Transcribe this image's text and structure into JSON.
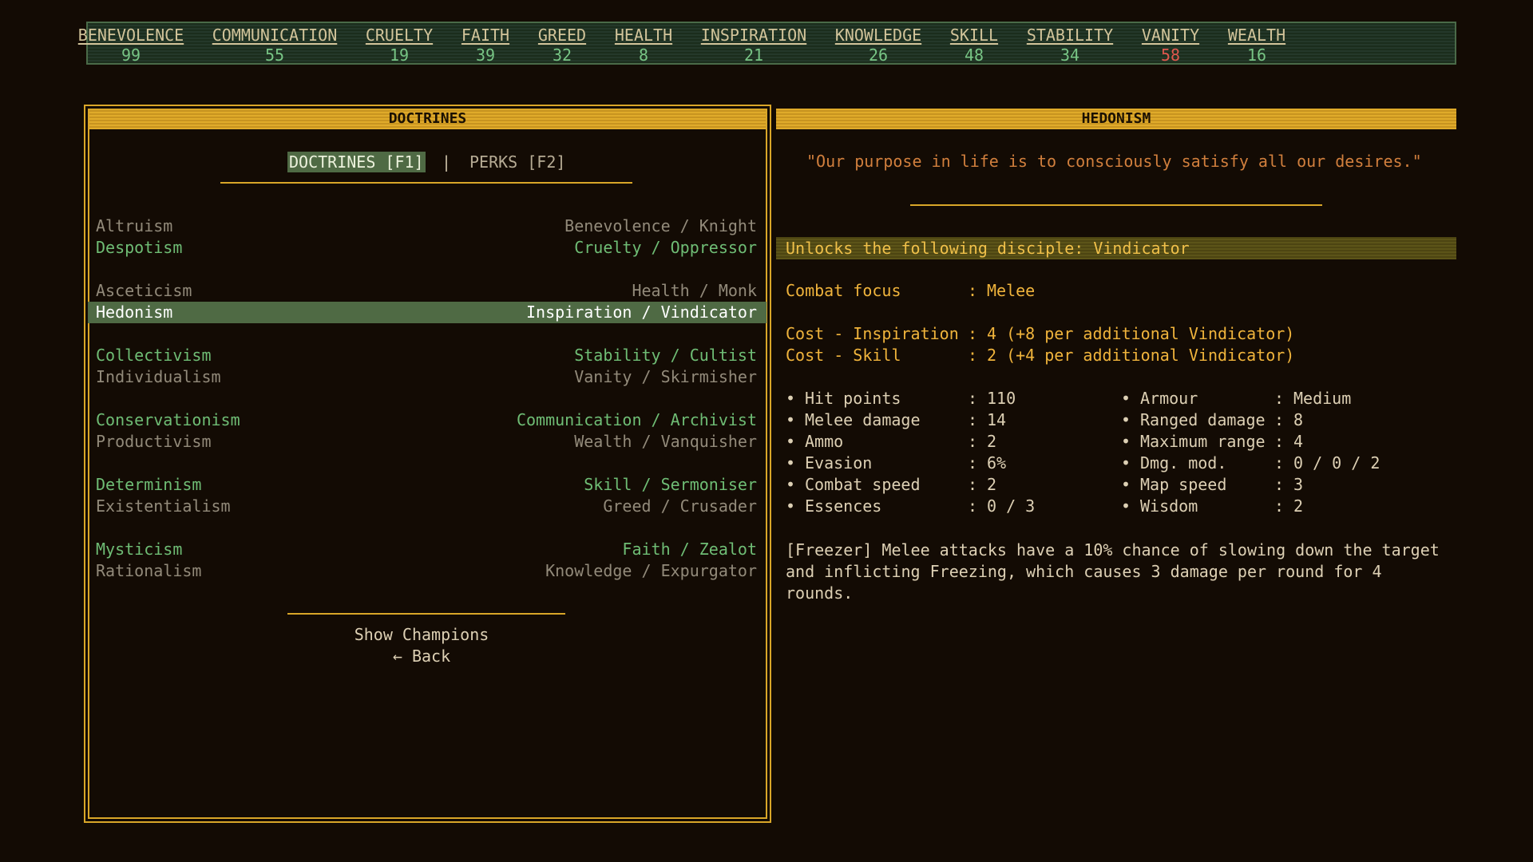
{
  "resources": [
    {
      "name": "BENEVOLENCE",
      "value": "99",
      "warn": false
    },
    {
      "name": "COMMUNICATION",
      "value": "55",
      "warn": false
    },
    {
      "name": "CRUELTY",
      "value": "19",
      "warn": false
    },
    {
      "name": "FAITH",
      "value": "39",
      "warn": false
    },
    {
      "name": "GREED",
      "value": "32",
      "warn": false
    },
    {
      "name": "HEALTH",
      "value": "8",
      "warn": false
    },
    {
      "name": "INSPIRATION",
      "value": "21",
      "warn": false
    },
    {
      "name": "KNOWLEDGE",
      "value": "26",
      "warn": false
    },
    {
      "name": "SKILL",
      "value": "48",
      "warn": false
    },
    {
      "name": "STABILITY",
      "value": "34",
      "warn": false
    },
    {
      "name": "VANITY",
      "value": "58",
      "warn": true
    },
    {
      "name": "WEALTH",
      "value": "16",
      "warn": false
    }
  ],
  "left_panel": {
    "title": "DOCTRINES",
    "tabs": {
      "doctrines": "DOCTRINES [F1]",
      "separator": "|",
      "perks": "PERKS [F2]"
    },
    "doctrines": [
      {
        "name": "Altruism",
        "stat": "Benevolence / Knight",
        "state": "gray"
      },
      {
        "name": "Despotism",
        "stat": "Cruelty / Oppressor",
        "state": "green"
      },
      {
        "name": "Asceticism",
        "stat": "Health / Monk",
        "state": "gray"
      },
      {
        "name": "Hedonism",
        "stat": "Inspiration / Vindicator",
        "state": "selected"
      },
      {
        "name": "Collectivism",
        "stat": "Stability / Cultist",
        "state": "green"
      },
      {
        "name": "Individualism",
        "stat": "Vanity / Skirmisher",
        "state": "gray"
      },
      {
        "name": "Conservationism",
        "stat": "Communication / Archivist",
        "state": "green"
      },
      {
        "name": "Productivism",
        "stat": "Wealth / Vanquisher",
        "state": "gray"
      },
      {
        "name": "Determinism",
        "stat": "Skill / Sermoniser",
        "state": "green"
      },
      {
        "name": "Existentialism",
        "stat": "Greed / Crusader",
        "state": "gray"
      },
      {
        "name": "Mysticism",
        "stat": "Faith / Zealot",
        "state": "green"
      },
      {
        "name": "Rationalism",
        "stat": "Knowledge / Expurgator",
        "state": "gray"
      }
    ],
    "show_champions": "Show Champions",
    "back": "← Back"
  },
  "right_panel": {
    "title": "HEDONISM",
    "quote": "\"Our purpose in life is to consciously satisfy all our desires.\"",
    "unlock": "Unlocks the following disciple: Vindicator",
    "combat_focus": {
      "label": "Combat focus",
      "value": "Melee"
    },
    "costs": [
      {
        "label": "Cost - Inspiration",
        "value": "4 (+8 per additional Vindicator)"
      },
      {
        "label": "Cost - Skill",
        "value": "2 (+4 per additional Vindicator)"
      }
    ],
    "stats_left": [
      {
        "label": "Hit points",
        "value": "110"
      },
      {
        "label": "Melee damage",
        "value": "14"
      },
      {
        "label": "Ammo",
        "value": "2"
      },
      {
        "label": "Evasion",
        "value": "6%"
      },
      {
        "label": "Combat speed",
        "value": "2"
      },
      {
        "label": "Essences",
        "value": "0 / 3"
      }
    ],
    "stats_right": [
      {
        "label": "Armour",
        "value": "Medium"
      },
      {
        "label": "Ranged damage",
        "value": "8"
      },
      {
        "label": "Maximum range",
        "value": "4"
      },
      {
        "label": "Dmg. mod.",
        "value": "0 / 0 / 2"
      },
      {
        "label": "Map speed",
        "value": "3"
      },
      {
        "label": "Wisdom",
        "value": "2"
      }
    ],
    "ability": "[Freezer] Melee attacks have a 10% chance of slowing down the target and inflicting Freezing, which causes 3 damage per round for 4 rounds."
  }
}
